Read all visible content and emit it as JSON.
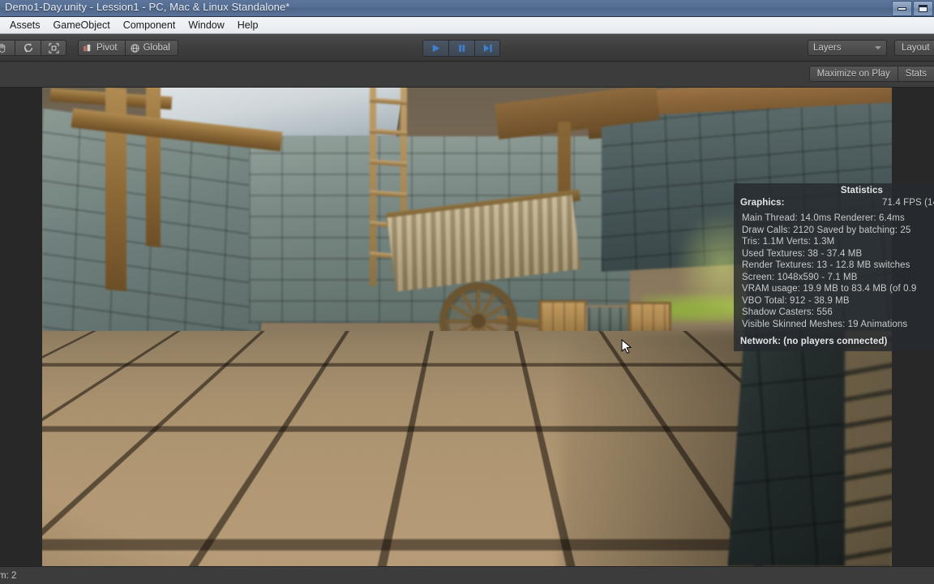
{
  "window": {
    "title": "Demo1-Day.unity - Lession1 - PC, Mac & Linux Standalone*",
    "minimize_label": "Minimize",
    "maximize_label": "Maximize"
  },
  "menubar": {
    "items": [
      {
        "label": "Assets"
      },
      {
        "label": "GameObject"
      },
      {
        "label": "Component"
      },
      {
        "label": "Window"
      },
      {
        "label": "Help"
      }
    ]
  },
  "toolbar": {
    "tools": [
      {
        "name": "rotate-tool",
        "label": "Rotate"
      },
      {
        "name": "rect-transform-tool",
        "label": "Rect Transform"
      }
    ],
    "pivot_label": "Pivot",
    "global_label": "Global",
    "play_label": "Play",
    "pause_label": "Pause",
    "step_label": "Step",
    "layers_label": "Layers",
    "layout_label": "Layout"
  },
  "gameview": {
    "maximize_on_play_label": "Maximize on Play",
    "stats_label": "Stats"
  },
  "statistics": {
    "title": "Statistics",
    "graphics_label": "Graphics:",
    "fps": "71.4 FPS (14",
    "lines": [
      "Main Thread: 14.0ms  Renderer: 6.4ms",
      "Draw Calls: 2120 Saved by batching: 25",
      "Tris: 1.1M    Verts: 1.3M",
      "Used Textures: 38 - 37.4 MB",
      "Render Textures: 13 - 12.8 MB  switches",
      "Screen: 1048x590 - 7.1 MB",
      "VRAM usage: 19.9 MB to 83.4 MB (of 0.9",
      "VBO Total: 912 - 38.9 MB",
      "Shadow Casters: 556",
      "Visible Skinned Meshes: 19    Animations"
    ],
    "network": "Network: (no players connected)"
  },
  "statusbar": {
    "text": "m: 2"
  },
  "colors": {
    "titlebar": "#556e94",
    "toolbar": "#3e3e3e",
    "play_accent": "#3f7fd0",
    "panel": "#3c3c3c"
  }
}
